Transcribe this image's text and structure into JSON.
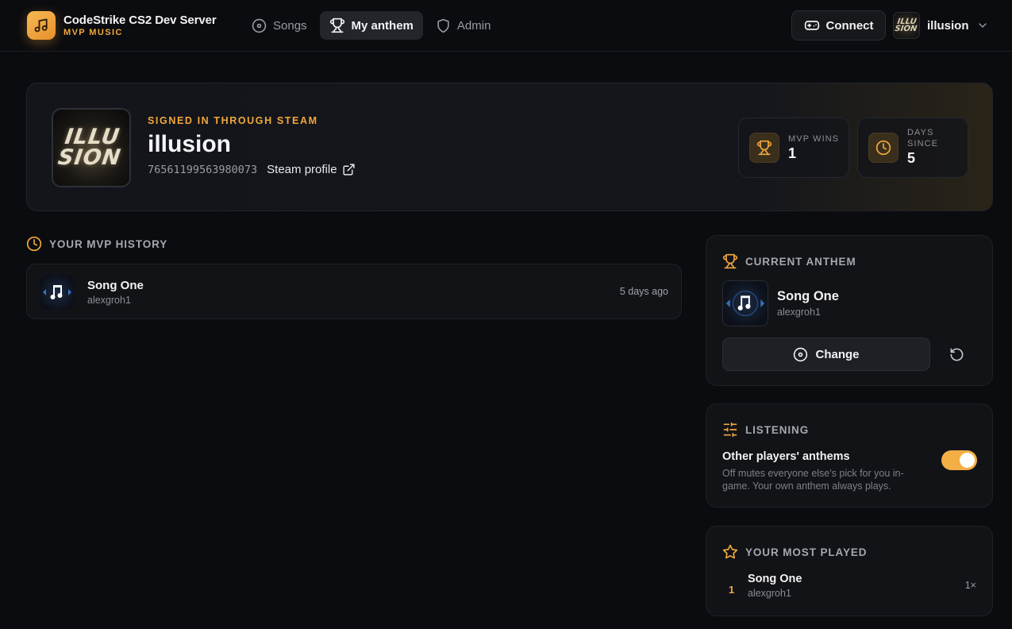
{
  "brand": {
    "title": "CodeStrike CS2 Dev Server",
    "subtitle": "MVP MUSIC",
    "icon": "music-note-icon"
  },
  "nav": {
    "items": [
      {
        "label": "Songs",
        "icon": "disc-icon",
        "active": false
      },
      {
        "label": "My anthem",
        "icon": "trophy-icon",
        "active": true
      },
      {
        "label": "Admin",
        "icon": "shield-icon",
        "active": false
      }
    ]
  },
  "header": {
    "connect_label": "Connect",
    "user_name": "illusion"
  },
  "profile": {
    "signed_in_label": "SIGNED IN THROUGH STEAM",
    "name": "illusion",
    "steam_id": "76561199563980073",
    "steam_profile_label": "Steam profile",
    "avatar_text": "ILLU SION",
    "stats": [
      {
        "label": "MVP WINS",
        "value": "1",
        "icon": "trophy-icon"
      },
      {
        "label": "DAYS SINCE",
        "value": "5",
        "icon": "clock-icon"
      }
    ]
  },
  "history": {
    "title": "YOUR MVP HISTORY",
    "items": [
      {
        "title": "Song One",
        "artist": "alexgroh1",
        "time": "5 days ago"
      }
    ]
  },
  "anthem": {
    "title": "CURRENT ANTHEM",
    "song_title": "Song One",
    "artist": "alexgroh1",
    "change_label": "Change"
  },
  "listening": {
    "title": "LISTENING",
    "setting_title": "Other players' anthems",
    "setting_desc": "Off mutes everyone else's pick for you in-game. Your own anthem always plays.",
    "enabled": true
  },
  "most_played": {
    "title": "YOUR MOST PLAYED",
    "items": [
      {
        "rank": "1",
        "title": "Song One",
        "artist": "alexgroh1",
        "count": "1×"
      }
    ]
  },
  "colors": {
    "accent": "#f0a83c",
    "background": "#0b0c0f",
    "card": "#121317"
  }
}
